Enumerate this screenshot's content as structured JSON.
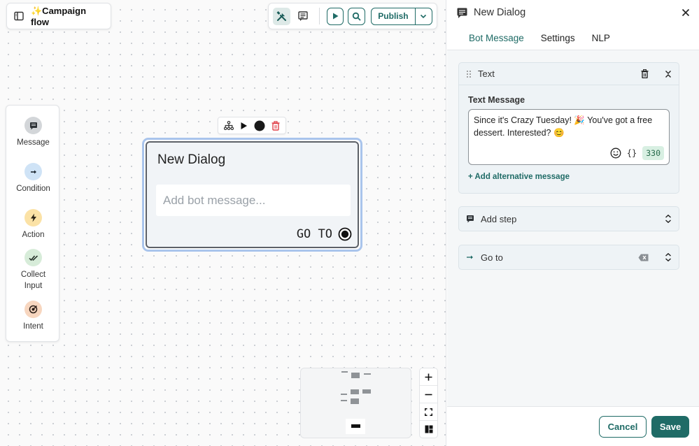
{
  "flow": {
    "title": "✨Campaign flow"
  },
  "toolbar": {
    "publish_label": "Publish"
  },
  "palette": {
    "items": [
      {
        "label": "Message",
        "icon": "message-icon",
        "color": "#d3d6d9"
      },
      {
        "label": "Condition",
        "icon": "arrow-right-icon",
        "color": "#cfe3f6"
      },
      {
        "label": "Action",
        "icon": "lightning-icon",
        "color": "#fbe2a6"
      },
      {
        "label": "Collect Input",
        "icon": "double-check-icon",
        "color": "#d7ecd9"
      },
      {
        "label": "Intent",
        "icon": "target-icon",
        "color": "#f7d6bf"
      }
    ]
  },
  "node": {
    "title": "New Dialog",
    "message_placeholder": "Add bot message...",
    "goto_label": "GO TO"
  },
  "panel": {
    "title": "New Dialog",
    "tabs": [
      {
        "label": "Bot Message",
        "active": true
      },
      {
        "label": "Settings",
        "active": false
      },
      {
        "label": "NLP",
        "active": false
      }
    ],
    "text_card": {
      "header": "Text",
      "field_label": "Text Message",
      "message": "Since it's Crazy Tuesday! 🎉 You've got a free dessert. Interested? 😊",
      "char_count": "330",
      "variables_label": "{}",
      "add_alternative": "+ Add alternative message"
    },
    "add_step": {
      "label": "Add step"
    },
    "goto": {
      "label": "Go to"
    },
    "footer": {
      "cancel": "Cancel",
      "save": "Save"
    }
  },
  "colors": {
    "accent": "#1f6b66",
    "node_selection": "#a9c4ec",
    "delete": "#e0424a"
  }
}
